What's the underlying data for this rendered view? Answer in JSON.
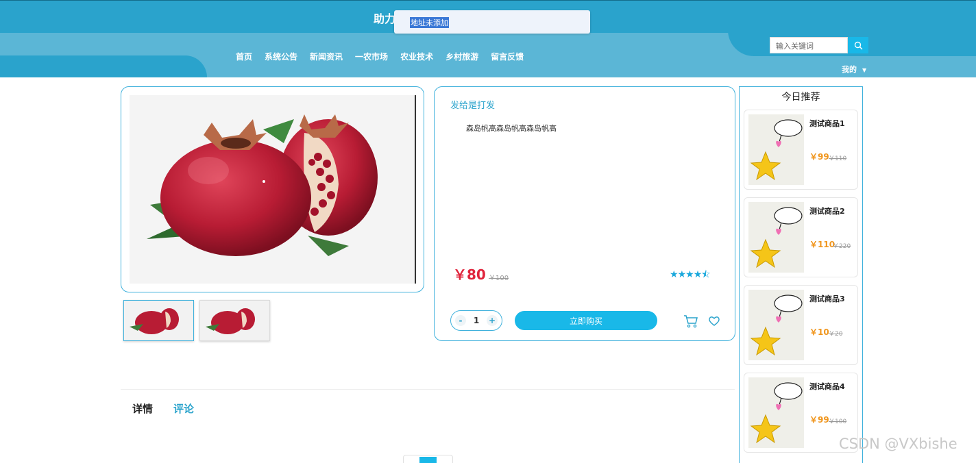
{
  "header": {
    "site_title": "助力",
    "nav": [
      "首页",
      "系统公告",
      "新闻资讯",
      "一农市场",
      "农业技术",
      "乡村旅游",
      "留言反馈"
    ],
    "search_placeholder": "输入关键词",
    "mine": "我的",
    "popup_text": "地址未添加"
  },
  "product": {
    "title": "发给是打发",
    "description": "森岛帆高森岛帆高森岛帆高",
    "price": "￥80",
    "original_price": "￥100",
    "rating": 4.5,
    "quantity": "1",
    "qty_minus": "-",
    "qty_plus": "+",
    "buy_label": "立即购买"
  },
  "tabs": {
    "details": "详情",
    "comments": "评论"
  },
  "sidebar": {
    "title": "今日推荐",
    "items": [
      {
        "name": "测试商品1",
        "price": "￥99",
        "original": "￥110"
      },
      {
        "name": "测试商品2",
        "price": "￥110",
        "original": "￥220"
      },
      {
        "name": "测试商品3",
        "price": "￥10",
        "original": "￥20"
      },
      {
        "name": "测试商品4",
        "price": "￥99",
        "original": "￥100"
      }
    ]
  },
  "watermark": "CSDN @VXbishe",
  "colors": {
    "primary": "#2aa3cc",
    "accent": "#19b8e8",
    "price": "#e0243c",
    "rec_price": "#f0961e"
  }
}
